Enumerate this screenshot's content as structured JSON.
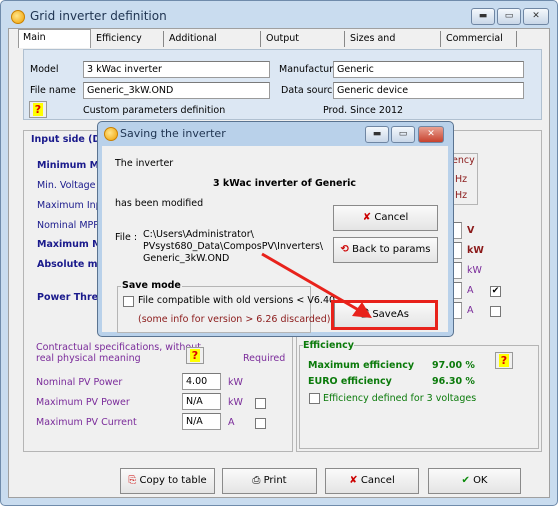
{
  "window": {
    "title": "Grid inverter definition",
    "controls": [
      "minimize",
      "maximize",
      "close"
    ]
  },
  "tabs": [
    "Main parameters",
    "Efficiency curve",
    "Additional parameters",
    "Output parameters",
    "Sizes and Technology",
    "Commercial data"
  ],
  "header": {
    "model_label": "Model",
    "model_value": "3 kWac inverter",
    "filename_label": "File name",
    "filename_value": "Generic_3kW.OND",
    "manufacturer_label": "Manufacturer",
    "manufacturer_value": "Generic",
    "datasource_label": "Data source",
    "datasource_value": "Generic device",
    "help": "?",
    "custom_text": "Custom parameters definition",
    "prod_since": "Prod. Since 2012"
  },
  "input_side": {
    "title": "Input side (DC",
    "rows": [
      "Minimum MP",
      "Min. Voltage fo",
      "Maximum Input",
      "Nominal  MPP V",
      "Maximum MI",
      "Absolute ma",
      "Power Thresh"
    ],
    "frequency_title": "ency",
    "hz1": "Hz",
    "hz2": "Hz",
    "units": [
      "V",
      "kW",
      "kW",
      "A",
      "A"
    ],
    "checkbox_a1_checked": true,
    "checkbox_a2_checked": false
  },
  "contractual": {
    "line1": "Contractual specifications,  without",
    "line2": "real physical meaning",
    "help": "?",
    "required": "Required",
    "nominal_label": "Nominal PV Power",
    "nominal_value": "4.00",
    "nominal_unit": "kW",
    "maxpower_label": "Maximum PV Power",
    "maxpower_value": "N/A",
    "maxpower_unit": "kW",
    "maxcurrent_label": "Maximum PV Current",
    "maxcurrent_value": "N/A",
    "maxcurrent_unit": "A"
  },
  "efficiency": {
    "title": "Efficiency",
    "max_label": "Maximum efficiency",
    "max_value": "97.00 %",
    "euro_label": "EURO efficiency",
    "euro_value": "96.30 %",
    "help": "?",
    "three_voltages": "Efficiency defined for 3 voltages"
  },
  "buttons": {
    "copy": "Copy to table",
    "print": "Print",
    "cancel": "Cancel",
    "ok": "OK"
  },
  "dialog": {
    "title": "Saving the inverter",
    "the_inverter": "The inverter",
    "name": "3 kWac inverter  of  Generic",
    "modified": "has  been modified",
    "file_label": "File :",
    "path1": "C:\\Users\\Administrator\\",
    "path2": "PVsyst680_Data\\ComposPV\\Inverters\\",
    "path3": "Generic_3kW.OND",
    "cancel": "Cancel",
    "back": "Back to params",
    "save_mode": "Save mode",
    "compat": "File compatible with old versions < V6.40",
    "compat_note": "(some info for version > 6.26 discarded)",
    "saveas": "SaveAs",
    "highlight_color": "#e8221b"
  }
}
